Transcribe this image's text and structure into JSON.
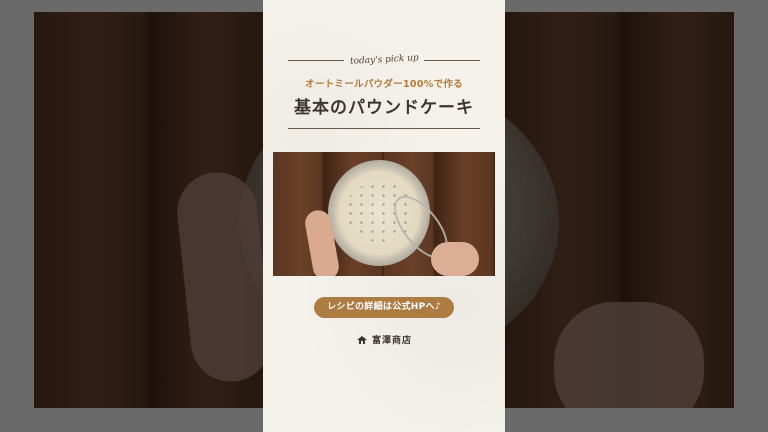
{
  "card": {
    "pickup_label": "today's pick up",
    "subtitle": "オートミールパウダー100%で作る",
    "title": "基本のパウンドケーキ",
    "cta_label": "レシピの詳細は公式HPへ♪",
    "brand_name": "富澤商店"
  },
  "colors": {
    "accent": "#ad7c43",
    "subtitle": "#b37a3a",
    "title": "#3d3530",
    "panel_bg": "#f5f2ec"
  },
  "icons": {
    "brand": "tomizawa-logo-icon"
  }
}
